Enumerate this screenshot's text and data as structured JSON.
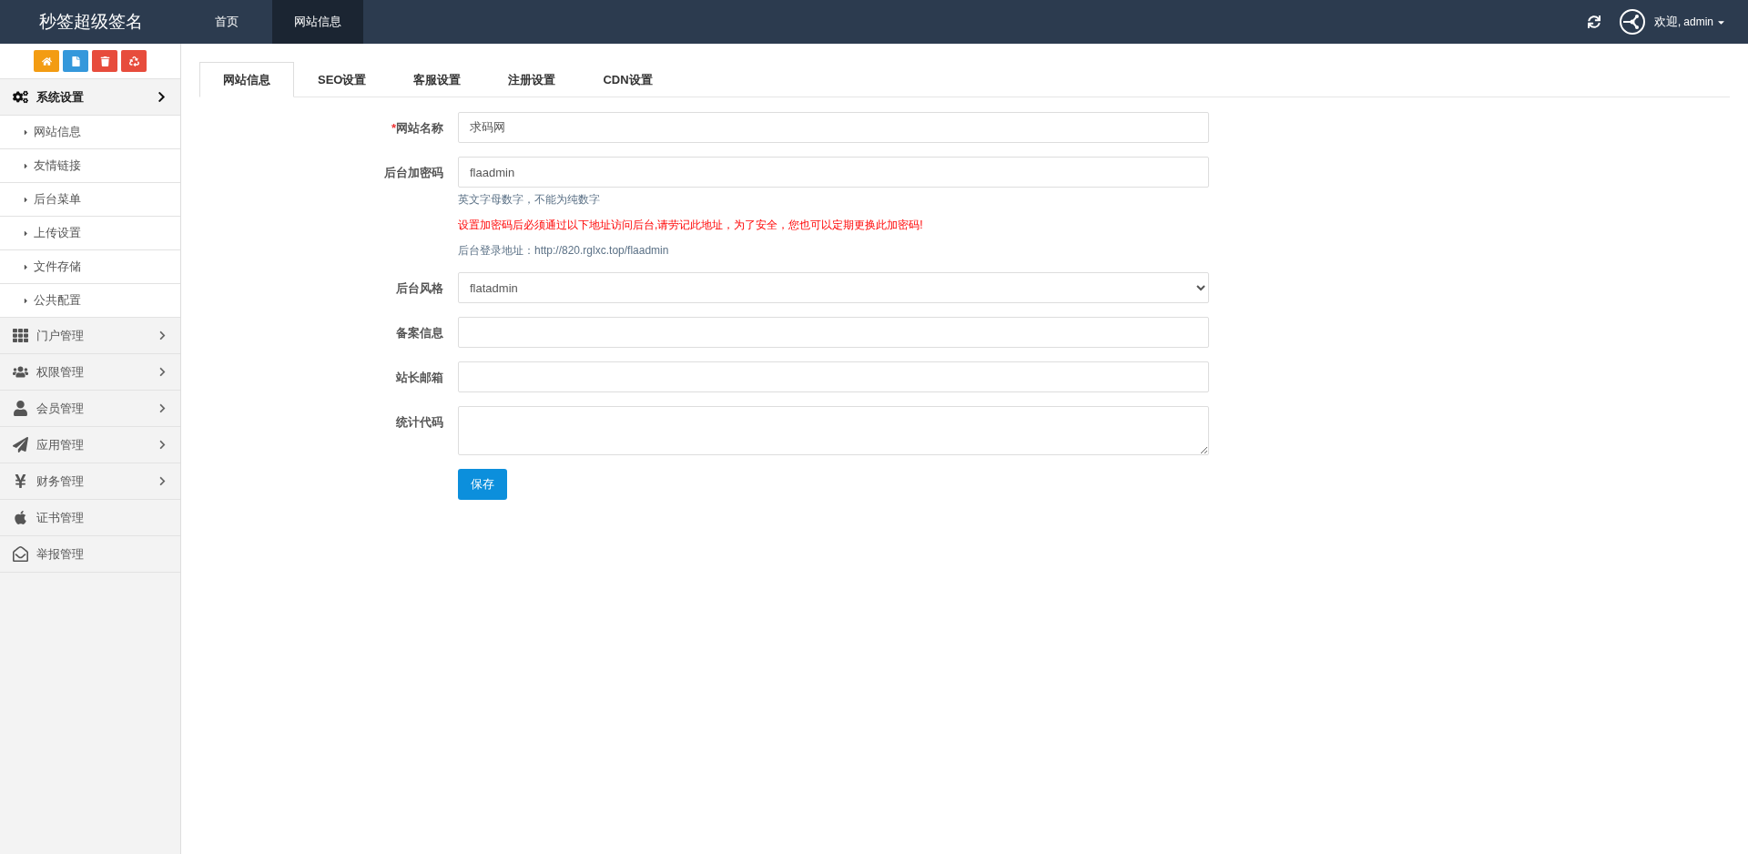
{
  "topbar": {
    "brand": "秒签超级签名",
    "nav": [
      {
        "label": "首页",
        "selected": false
      },
      {
        "label": "网站信息",
        "selected": true
      }
    ],
    "welcome": "欢迎,",
    "user": "admin"
  },
  "sidebar": {
    "groups": [
      {
        "label": "系统设置",
        "expanded": true,
        "children": [
          {
            "label": "网站信息"
          },
          {
            "label": "友情链接"
          },
          {
            "label": "后台菜单"
          },
          {
            "label": "上传设置"
          },
          {
            "label": "文件存储"
          },
          {
            "label": "公共配置"
          }
        ]
      },
      {
        "label": "门户管理",
        "expanded": false,
        "has_arrow": true
      },
      {
        "label": "权限管理",
        "expanded": false,
        "has_arrow": true
      },
      {
        "label": "会员管理",
        "expanded": false,
        "has_arrow": true
      },
      {
        "label": "应用管理",
        "expanded": false,
        "has_arrow": true
      },
      {
        "label": "财务管理",
        "expanded": false,
        "has_arrow": true
      },
      {
        "label": "证书管理",
        "expanded": false,
        "has_arrow": false
      },
      {
        "label": "举报管理",
        "expanded": false,
        "has_arrow": false
      }
    ]
  },
  "tabs": [
    {
      "label": "网站信息",
      "selected": true
    },
    {
      "label": "SEO设置",
      "selected": false
    },
    {
      "label": "客服设置",
      "selected": false
    },
    {
      "label": "注册设置",
      "selected": false
    },
    {
      "label": "CDN设置",
      "selected": false
    }
  ],
  "form": {
    "fields": [
      {
        "kind": "input",
        "label": "网站名称",
        "required_mark": "*",
        "value": "求码网"
      },
      {
        "kind": "input",
        "label": "后台加密码",
        "value": "flaadmin",
        "help": [
          {
            "text": "英文字母数字，不能为纯数字",
            "kind": "hint"
          },
          {
            "text": "设置加密码后必须通过以下地址访问后台,请劳记此地址，为了安全，您也可以定期更换此加密码!",
            "kind": "warning"
          },
          {
            "text": "后台登录地址：http://820.rglxc.top/flaadmin",
            "kind": "hint"
          }
        ]
      },
      {
        "kind": "select",
        "label": "后台风格",
        "value": "flatadmin"
      },
      {
        "kind": "input",
        "label": "备案信息"
      },
      {
        "kind": "input",
        "label": "站长邮箱"
      },
      {
        "kind": "textarea",
        "label": "统计代码"
      }
    ],
    "submit": "保存"
  }
}
